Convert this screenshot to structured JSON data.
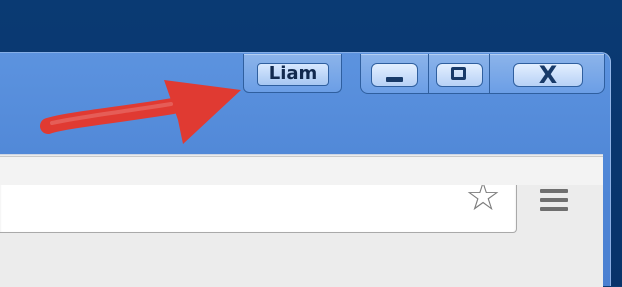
{
  "window": {
    "profile_button": {
      "label": "Liam"
    },
    "controls": {
      "minimize": {
        "icon": "minimize-icon"
      },
      "maximize": {
        "icon": "maximize-icon"
      },
      "close": {
        "label": "X"
      }
    }
  },
  "toolbar": {
    "bookmark_star": {
      "icon": "star-outline-icon",
      "glyph": "☆"
    },
    "menu": {
      "icon": "hamburger-menu-icon"
    }
  },
  "annotation": {
    "arrow_color": "#e03a32"
  },
  "colors": {
    "desktop": "#0b3b73",
    "titlebar": "#5a90dd",
    "toolbar": "#ececec",
    "omnibox": "#ffffff",
    "controls_border": "#2f5f9f"
  }
}
